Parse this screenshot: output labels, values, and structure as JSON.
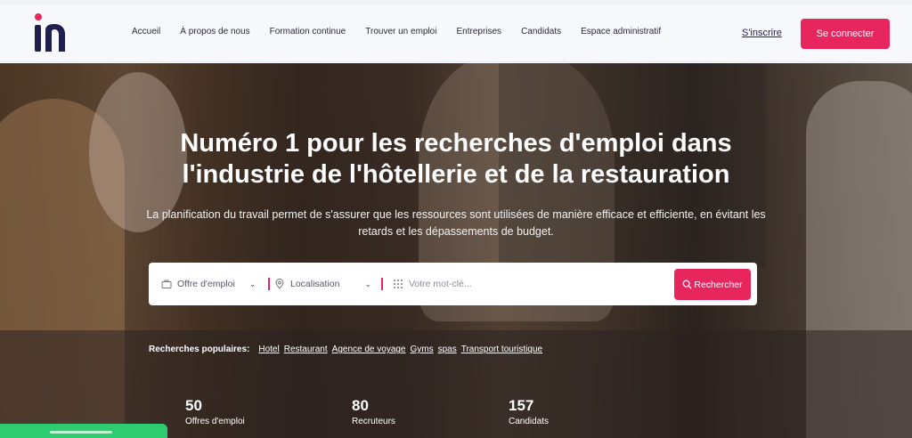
{
  "header": {
    "logo_text": "in",
    "nav": [
      "Accueil",
      "À propos de nous",
      "Formation continue",
      "Trouver un emploi",
      "Entreprises",
      "Candidats",
      "Espace administratif"
    ],
    "signup_label": "S'inscrire",
    "login_label": "Se connecter"
  },
  "hero": {
    "headline_line1": "Numéro 1 pour les recherches d'emploi dans",
    "headline_line2": "l'industrie de l'hôtellerie et de la restauration",
    "subline": "La planification du travail permet de s'assurer que les ressources sont utilisées de manière efficace et efficiente, en évitant les retards et les dépassements de budget."
  },
  "search": {
    "type_value": "Offre d'emploi",
    "location_value": "Localisation",
    "keyword_placeholder": "Votre mot-clé...",
    "button_label": "Rechercher"
  },
  "popular": {
    "label": "Recherches populaires:",
    "items": [
      "Hotel",
      "Restaurant",
      "Agence de voyage",
      "Gyms",
      "spas",
      "Transport touristique"
    ]
  },
  "stats": [
    {
      "value": "50",
      "label": "Offres d'emploi"
    },
    {
      "value": "80",
      "label": "Recruteurs"
    },
    {
      "value": "157",
      "label": "Candidats"
    }
  ],
  "colors": {
    "accent": "#e8265e",
    "logo_dark": "#1f1f4d",
    "green": "#2ecc71"
  }
}
